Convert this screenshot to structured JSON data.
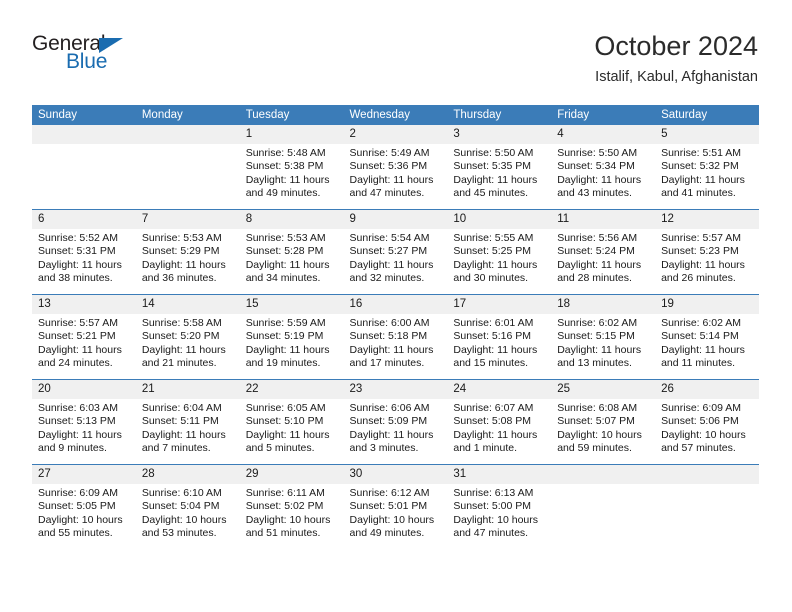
{
  "brand": {
    "name_part1": "General",
    "name_part2": "Blue",
    "triangle_color": "#1a6cb0",
    "text_color": "#231f20"
  },
  "header": {
    "month_title": "October 2024",
    "location": "Istalif, Kabul, Afghanistan"
  },
  "colors": {
    "header_blue": "#3b7cb8",
    "daynum_band": "#f0f0f0",
    "separator_blue": "#3b7cb8",
    "text": "#1a1a1a"
  },
  "calendar": {
    "weekday_headers": [
      "Sunday",
      "Monday",
      "Tuesday",
      "Wednesday",
      "Thursday",
      "Friday",
      "Saturday"
    ],
    "labels": {
      "sunrise": "Sunrise:",
      "sunset": "Sunset:",
      "daylight": "Daylight:"
    },
    "weeks": [
      [
        {
          "day": "",
          "sunrise": "",
          "sunset": "",
          "daylight_1": "",
          "daylight_2": "",
          "empty": true
        },
        {
          "day": "",
          "sunrise": "",
          "sunset": "",
          "daylight_1": "",
          "daylight_2": "",
          "empty": true
        },
        {
          "day": "1",
          "sunrise": "Sunrise: 5:48 AM",
          "sunset": "Sunset: 5:38 PM",
          "daylight_1": "Daylight: 11 hours",
          "daylight_2": "and 49 minutes."
        },
        {
          "day": "2",
          "sunrise": "Sunrise: 5:49 AM",
          "sunset": "Sunset: 5:36 PM",
          "daylight_1": "Daylight: 11 hours",
          "daylight_2": "and 47 minutes."
        },
        {
          "day": "3",
          "sunrise": "Sunrise: 5:50 AM",
          "sunset": "Sunset: 5:35 PM",
          "daylight_1": "Daylight: 11 hours",
          "daylight_2": "and 45 minutes."
        },
        {
          "day": "4",
          "sunrise": "Sunrise: 5:50 AM",
          "sunset": "Sunset: 5:34 PM",
          "daylight_1": "Daylight: 11 hours",
          "daylight_2": "and 43 minutes."
        },
        {
          "day": "5",
          "sunrise": "Sunrise: 5:51 AM",
          "sunset": "Sunset: 5:32 PM",
          "daylight_1": "Daylight: 11 hours",
          "daylight_2": "and 41 minutes."
        }
      ],
      [
        {
          "day": "6",
          "sunrise": "Sunrise: 5:52 AM",
          "sunset": "Sunset: 5:31 PM",
          "daylight_1": "Daylight: 11 hours",
          "daylight_2": "and 38 minutes."
        },
        {
          "day": "7",
          "sunrise": "Sunrise: 5:53 AM",
          "sunset": "Sunset: 5:29 PM",
          "daylight_1": "Daylight: 11 hours",
          "daylight_2": "and 36 minutes."
        },
        {
          "day": "8",
          "sunrise": "Sunrise: 5:53 AM",
          "sunset": "Sunset: 5:28 PM",
          "daylight_1": "Daylight: 11 hours",
          "daylight_2": "and 34 minutes."
        },
        {
          "day": "9",
          "sunrise": "Sunrise: 5:54 AM",
          "sunset": "Sunset: 5:27 PM",
          "daylight_1": "Daylight: 11 hours",
          "daylight_2": "and 32 minutes."
        },
        {
          "day": "10",
          "sunrise": "Sunrise: 5:55 AM",
          "sunset": "Sunset: 5:25 PM",
          "daylight_1": "Daylight: 11 hours",
          "daylight_2": "and 30 minutes."
        },
        {
          "day": "11",
          "sunrise": "Sunrise: 5:56 AM",
          "sunset": "Sunset: 5:24 PM",
          "daylight_1": "Daylight: 11 hours",
          "daylight_2": "and 28 minutes."
        },
        {
          "day": "12",
          "sunrise": "Sunrise: 5:57 AM",
          "sunset": "Sunset: 5:23 PM",
          "daylight_1": "Daylight: 11 hours",
          "daylight_2": "and 26 minutes."
        }
      ],
      [
        {
          "day": "13",
          "sunrise": "Sunrise: 5:57 AM",
          "sunset": "Sunset: 5:21 PM",
          "daylight_1": "Daylight: 11 hours",
          "daylight_2": "and 24 minutes."
        },
        {
          "day": "14",
          "sunrise": "Sunrise: 5:58 AM",
          "sunset": "Sunset: 5:20 PM",
          "daylight_1": "Daylight: 11 hours",
          "daylight_2": "and 21 minutes."
        },
        {
          "day": "15",
          "sunrise": "Sunrise: 5:59 AM",
          "sunset": "Sunset: 5:19 PM",
          "daylight_1": "Daylight: 11 hours",
          "daylight_2": "and 19 minutes."
        },
        {
          "day": "16",
          "sunrise": "Sunrise: 6:00 AM",
          "sunset": "Sunset: 5:18 PM",
          "daylight_1": "Daylight: 11 hours",
          "daylight_2": "and 17 minutes."
        },
        {
          "day": "17",
          "sunrise": "Sunrise: 6:01 AM",
          "sunset": "Sunset: 5:16 PM",
          "daylight_1": "Daylight: 11 hours",
          "daylight_2": "and 15 minutes."
        },
        {
          "day": "18",
          "sunrise": "Sunrise: 6:02 AM",
          "sunset": "Sunset: 5:15 PM",
          "daylight_1": "Daylight: 11 hours",
          "daylight_2": "and 13 minutes."
        },
        {
          "day": "19",
          "sunrise": "Sunrise: 6:02 AM",
          "sunset": "Sunset: 5:14 PM",
          "daylight_1": "Daylight: 11 hours",
          "daylight_2": "and 11 minutes."
        }
      ],
      [
        {
          "day": "20",
          "sunrise": "Sunrise: 6:03 AM",
          "sunset": "Sunset: 5:13 PM",
          "daylight_1": "Daylight: 11 hours",
          "daylight_2": "and 9 minutes."
        },
        {
          "day": "21",
          "sunrise": "Sunrise: 6:04 AM",
          "sunset": "Sunset: 5:11 PM",
          "daylight_1": "Daylight: 11 hours",
          "daylight_2": "and 7 minutes."
        },
        {
          "day": "22",
          "sunrise": "Sunrise: 6:05 AM",
          "sunset": "Sunset: 5:10 PM",
          "daylight_1": "Daylight: 11 hours",
          "daylight_2": "and 5 minutes."
        },
        {
          "day": "23",
          "sunrise": "Sunrise: 6:06 AM",
          "sunset": "Sunset: 5:09 PM",
          "daylight_1": "Daylight: 11 hours",
          "daylight_2": "and 3 minutes."
        },
        {
          "day": "24",
          "sunrise": "Sunrise: 6:07 AM",
          "sunset": "Sunset: 5:08 PM",
          "daylight_1": "Daylight: 11 hours",
          "daylight_2": "and 1 minute."
        },
        {
          "day": "25",
          "sunrise": "Sunrise: 6:08 AM",
          "sunset": "Sunset: 5:07 PM",
          "daylight_1": "Daylight: 10 hours",
          "daylight_2": "and 59 minutes."
        },
        {
          "day": "26",
          "sunrise": "Sunrise: 6:09 AM",
          "sunset": "Sunset: 5:06 PM",
          "daylight_1": "Daylight: 10 hours",
          "daylight_2": "and 57 minutes."
        }
      ],
      [
        {
          "day": "27",
          "sunrise": "Sunrise: 6:09 AM",
          "sunset": "Sunset: 5:05 PM",
          "daylight_1": "Daylight: 10 hours",
          "daylight_2": "and 55 minutes."
        },
        {
          "day": "28",
          "sunrise": "Sunrise: 6:10 AM",
          "sunset": "Sunset: 5:04 PM",
          "daylight_1": "Daylight: 10 hours",
          "daylight_2": "and 53 minutes."
        },
        {
          "day": "29",
          "sunrise": "Sunrise: 6:11 AM",
          "sunset": "Sunset: 5:02 PM",
          "daylight_1": "Daylight: 10 hours",
          "daylight_2": "and 51 minutes."
        },
        {
          "day": "30",
          "sunrise": "Sunrise: 6:12 AM",
          "sunset": "Sunset: 5:01 PM",
          "daylight_1": "Daylight: 10 hours",
          "daylight_2": "and 49 minutes."
        },
        {
          "day": "31",
          "sunrise": "Sunrise: 6:13 AM",
          "sunset": "Sunset: 5:00 PM",
          "daylight_1": "Daylight: 10 hours",
          "daylight_2": "and 47 minutes."
        },
        {
          "day": "",
          "sunrise": "",
          "sunset": "",
          "daylight_1": "",
          "daylight_2": "",
          "empty": true
        },
        {
          "day": "",
          "sunrise": "",
          "sunset": "",
          "daylight_1": "",
          "daylight_2": "",
          "empty": true
        }
      ]
    ]
  }
}
